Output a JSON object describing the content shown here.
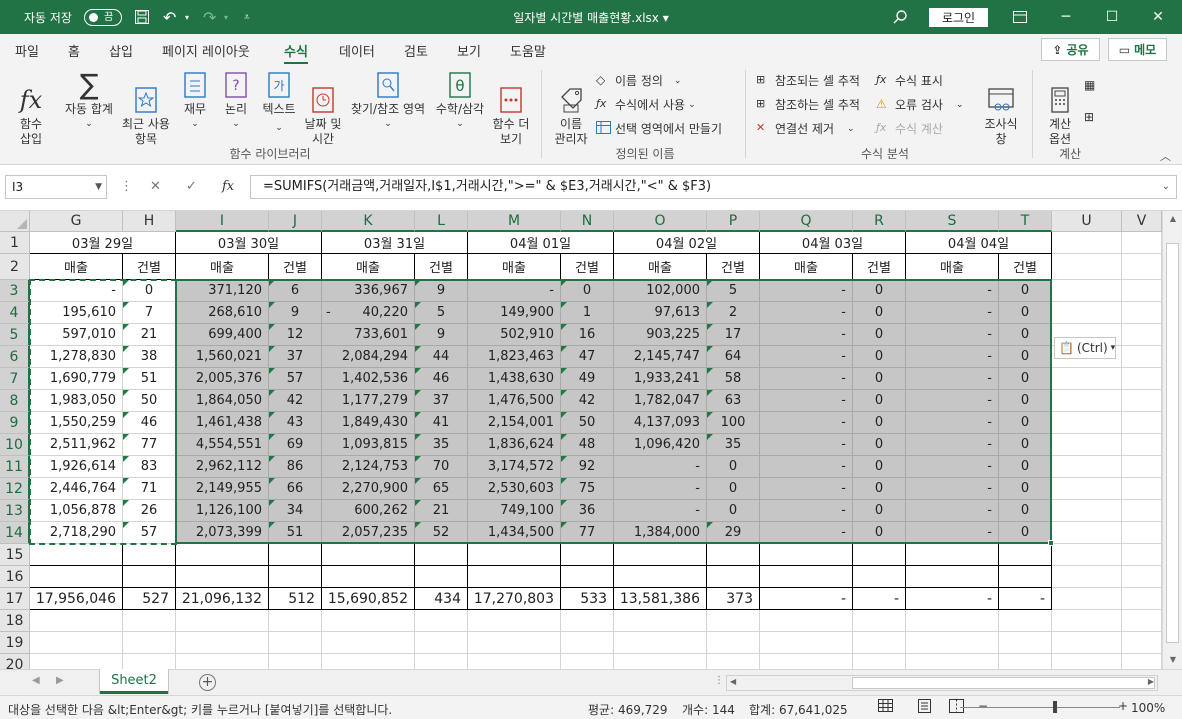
{
  "titlebar": {
    "autosave_label": "자동 저장",
    "autosave_state": "끔",
    "doc_title": "일자별 시간별 매출현황.xlsx ▾",
    "login_label": "로그인"
  },
  "ribbon_tabs": [
    "파일",
    "홈",
    "삽입",
    "페이지 레이아웃",
    "수식",
    "데이터",
    "검토",
    "보기",
    "도움말"
  ],
  "active_tab": "수식",
  "share_label": "공유",
  "memo_label": "메모",
  "ribbon": {
    "insert_function": "함수\n삽입",
    "autosum": "자동 합계",
    "recent": "최근 사용\n항목",
    "financial": "재무",
    "logical": "논리",
    "text": "텍스트",
    "datetime": "날짜 및\n시간",
    "lookup": "찾기/참조 영역",
    "math": "수학/삼각",
    "more": "함수 더\n보기",
    "group_library": "함수 라이브러리",
    "name_manager": "이름\n관리자",
    "define_name": "이름 정의",
    "use_in_formula": "수식에서 사용",
    "create_from_selection": "선택 영역에서 만들기",
    "group_names": "정의된 이름",
    "trace_precedents": "참조되는 셀 추적",
    "trace_dependents": "참조하는 셀 추적",
    "remove_arrows": "연결선 제거",
    "show_formulas": "수식 표시",
    "error_checking": "오류 검사",
    "evaluate_formula": "수식 계산",
    "watch_window": "조사식\n창",
    "group_audit": "수식 분석",
    "calc_options": "계산\n옵션",
    "group_calc": "계산"
  },
  "formula_bar": {
    "name_box": "I3",
    "formula": "=SUMIFS(거래금액,거래일자,I$1,거래시간,\">=\" & $E3,거래시간,\"<\" & $F3)"
  },
  "columns": [
    "G",
    "H",
    "I",
    "J",
    "K",
    "L",
    "M",
    "N",
    "O",
    "P",
    "Q",
    "R",
    "S",
    "T",
    "U",
    "V"
  ],
  "rows": [
    "1",
    "2",
    "3",
    "4",
    "5",
    "6",
    "7",
    "8",
    "9",
    "10",
    "11",
    "12",
    "13",
    "14",
    "15",
    "16",
    "17",
    "18",
    "19",
    "20"
  ],
  "dates": [
    "03월 29일",
    "03월 30일",
    "03월 31일",
    "04월 01일",
    "04월 02일",
    "04월 03일",
    "04월 04일"
  ],
  "sub_headers": [
    "매출",
    "건별"
  ],
  "data_rows": [
    [
      [
        "-",
        "0"
      ],
      [
        "371,120",
        "6"
      ],
      [
        "336,967",
        "9"
      ],
      [
        "-",
        "0"
      ],
      [
        "102,000",
        "5"
      ],
      [
        "-",
        "0"
      ],
      [
        "-",
        "0"
      ]
    ],
    [
      [
        "195,610",
        "7"
      ],
      [
        "268,610",
        "9"
      ],
      [
        "40,220",
        "5"
      ],
      [
        "149,900",
        "1"
      ],
      [
        "97,613",
        "2"
      ],
      [
        "-",
        "0"
      ],
      [
        "-",
        "0"
      ]
    ],
    [
      [
        "597,010",
        "21"
      ],
      [
        "699,400",
        "12"
      ],
      [
        "733,601",
        "9"
      ],
      [
        "502,910",
        "16"
      ],
      [
        "903,225",
        "17"
      ],
      [
        "-",
        "0"
      ],
      [
        "-",
        "0"
      ]
    ],
    [
      [
        "1,278,830",
        "38"
      ],
      [
        "1,560,021",
        "37"
      ],
      [
        "2,084,294",
        "44"
      ],
      [
        "1,823,463",
        "47"
      ],
      [
        "2,145,747",
        "64"
      ],
      [
        "-",
        "0"
      ],
      [
        "-",
        "0"
      ]
    ],
    [
      [
        "1,690,779",
        "51"
      ],
      [
        "2,005,376",
        "57"
      ],
      [
        "1,402,536",
        "46"
      ],
      [
        "1,438,630",
        "49"
      ],
      [
        "1,933,241",
        "58"
      ],
      [
        "-",
        "0"
      ],
      [
        "-",
        "0"
      ]
    ],
    [
      [
        "1,983,050",
        "50"
      ],
      [
        "1,864,050",
        "42"
      ],
      [
        "1,177,279",
        "37"
      ],
      [
        "1,476,500",
        "42"
      ],
      [
        "1,782,047",
        "63"
      ],
      [
        "-",
        "0"
      ],
      [
        "-",
        "0"
      ]
    ],
    [
      [
        "1,550,259",
        "46"
      ],
      [
        "1,461,438",
        "43"
      ],
      [
        "1,849,430",
        "41"
      ],
      [
        "2,154,001",
        "50"
      ],
      [
        "4,137,093",
        "100"
      ],
      [
        "-",
        "0"
      ],
      [
        "-",
        "0"
      ]
    ],
    [
      [
        "2,511,962",
        "77"
      ],
      [
        "4,554,551",
        "69"
      ],
      [
        "1,093,815",
        "35"
      ],
      [
        "1,836,624",
        "48"
      ],
      [
        "1,096,420",
        "35"
      ],
      [
        "-",
        "0"
      ],
      [
        "-",
        "0"
      ]
    ],
    [
      [
        "1,926,614",
        "83"
      ],
      [
        "2,962,112",
        "86"
      ],
      [
        "2,124,753",
        "70"
      ],
      [
        "3,174,572",
        "92"
      ],
      [
        "-",
        "0"
      ],
      [
        "-",
        "0"
      ],
      [
        "-",
        "0"
      ]
    ],
    [
      [
        "2,446,764",
        "71"
      ],
      [
        "2,149,955",
        "66"
      ],
      [
        "2,270,900",
        "65"
      ],
      [
        "2,530,603",
        "75"
      ],
      [
        "-",
        "0"
      ],
      [
        "-",
        "0"
      ],
      [
        "-",
        "0"
      ]
    ],
    [
      [
        "1,056,878",
        "26"
      ],
      [
        "1,126,100",
        "34"
      ],
      [
        "600,262",
        "21"
      ],
      [
        "749,100",
        "36"
      ],
      [
        "-",
        "0"
      ],
      [
        "-",
        "0"
      ],
      [
        "-",
        "0"
      ]
    ],
    [
      [
        "2,718,290",
        "57"
      ],
      [
        "2,073,399",
        "51"
      ],
      [
        "2,057,235",
        "52"
      ],
      [
        "1,434,500",
        "77"
      ],
      [
        "1,384,000",
        "29"
      ],
      [
        "-",
        "0"
      ],
      [
        "-",
        "0"
      ]
    ]
  ],
  "k4_prefix": "-",
  "totals": [
    [
      "17,956,046",
      "527"
    ],
    [
      "21,096,132",
      "512"
    ],
    [
      "15,690,852",
      "434"
    ],
    [
      "17,270,803",
      "533"
    ],
    [
      "13,581,386",
      "373"
    ],
    [
      "-",
      "-"
    ],
    [
      "-",
      "-"
    ]
  ],
  "paste_options": "(Ctrl)",
  "sheet_tab": "Sheet2",
  "status": {
    "message": "대상을 선택한 다음 &lt;Enter&gt; 키를 누르거나 [붙여넣기]를 선택합니다.",
    "average": "평균:  469,729",
    "count": "개수: 144",
    "sum": "합계:  67,641,025",
    "zoom": "100%"
  }
}
